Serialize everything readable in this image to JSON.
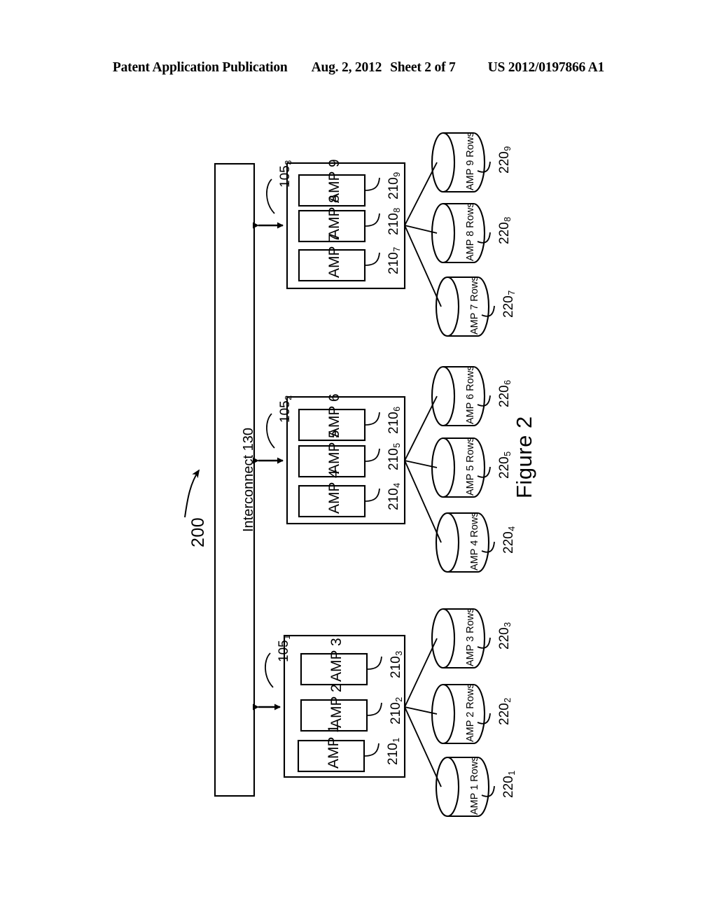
{
  "header": {
    "left": "Patent Application Publication",
    "date": "Aug. 2, 2012",
    "sheet": "Sheet 2 of 7",
    "right": "US 2012/0197866 A1"
  },
  "figure": {
    "caption": "Figure 2",
    "system_ref": "200"
  },
  "interconnect": {
    "label": "Interconnect ",
    "ref": "130"
  },
  "groups": [
    {
      "ref_base": "105",
      "ref_sub": "3",
      "amps": [
        {
          "label": "AMP 9",
          "ref_base": "210",
          "ref_sub": "9"
        },
        {
          "label": "AMP 8",
          "ref_base": "210",
          "ref_sub": "8"
        },
        {
          "label": "AMP 7",
          "ref_base": "210",
          "ref_sub": "7"
        }
      ]
    },
    {
      "ref_base": "105",
      "ref_sub": "2",
      "amps": [
        {
          "label": "AMP 6",
          "ref_base": "210",
          "ref_sub": "6"
        },
        {
          "label": "AMP 5",
          "ref_base": "210",
          "ref_sub": "5"
        },
        {
          "label": "AMP 4",
          "ref_base": "210",
          "ref_sub": "4"
        }
      ]
    },
    {
      "ref_base": "105",
      "ref_sub": "1",
      "amps": [
        {
          "label": "AMP 3",
          "ref_base": "210",
          "ref_sub": "3"
        },
        {
          "label": "AMP 2",
          "ref_base": "210",
          "ref_sub": "2"
        },
        {
          "label": "AMP 1",
          "ref_base": "210",
          "ref_sub": "1"
        }
      ]
    }
  ],
  "stores": [
    {
      "label": "AMP 9 Rows",
      "ref_base": "220",
      "ref_sub": "9"
    },
    {
      "label": "AMP 8 Rows",
      "ref_base": "220",
      "ref_sub": "8"
    },
    {
      "label": "AMP 7 Rows",
      "ref_base": "220",
      "ref_sub": "7"
    },
    {
      "label": "AMP 6 Rows",
      "ref_base": "220",
      "ref_sub": "6"
    },
    {
      "label": "AMP 5 Rows",
      "ref_base": "220",
      "ref_sub": "5"
    },
    {
      "label": "AMP 4 Rows",
      "ref_base": "220",
      "ref_sub": "4"
    },
    {
      "label": "AMP 3 Rows",
      "ref_base": "220",
      "ref_sub": "3"
    },
    {
      "label": "AMP 2 Rows",
      "ref_base": "220",
      "ref_sub": "2"
    },
    {
      "label": "AMP 1 Rows",
      "ref_base": "220",
      "ref_sub": "1"
    }
  ],
  "colors": {
    "ink": "#000000",
    "paper": "#ffffff"
  }
}
